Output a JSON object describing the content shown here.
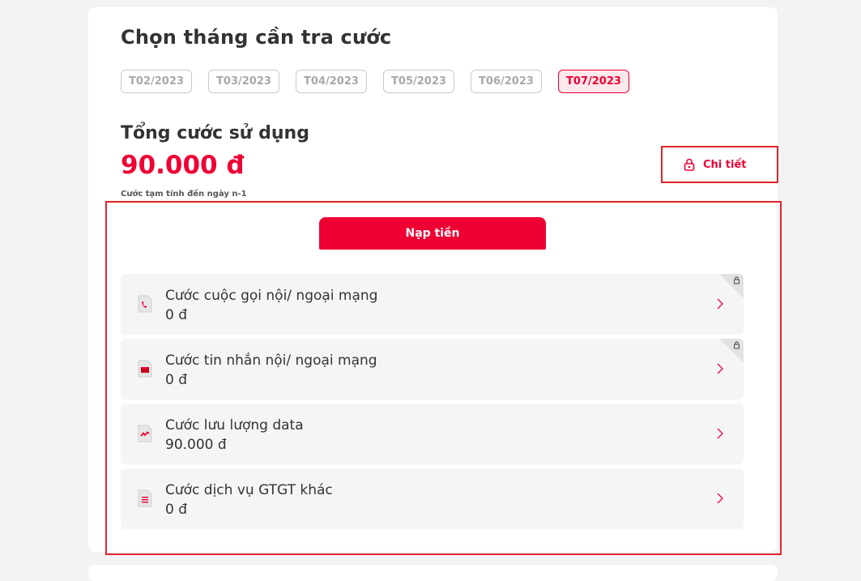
{
  "header": {
    "title": "Chọn tháng cần tra cước"
  },
  "months": [
    {
      "label": "T02/2023",
      "active": false
    },
    {
      "label": "T03/2023",
      "active": false
    },
    {
      "label": "T04/2023",
      "active": false
    },
    {
      "label": "T05/2023",
      "active": false
    },
    {
      "label": "T06/2023",
      "active": false
    },
    {
      "label": "T07/2023",
      "active": true
    }
  ],
  "summary": {
    "label": "Tổng cước sử dụng",
    "amount": "90.000 đ",
    "note": "Cước tạm tính đến ngày n-1",
    "detail_label": "Chi tiết"
  },
  "topup": {
    "label": "Nạp tiền"
  },
  "items": [
    {
      "label": "Cước cuộc gọi nội/ ngoại mạng",
      "value": "0 đ",
      "icon": "phone-icon",
      "locked": true
    },
    {
      "label": "Cước tin nhắn nội/ ngoại mạng",
      "value": "0 đ",
      "icon": "message-icon",
      "locked": true
    },
    {
      "label": "Cước lưu lượng data",
      "value": "90.000 đ",
      "icon": "data-icon",
      "locked": false
    },
    {
      "label": "Cước dịch vụ GTGT khác",
      "value": "0 đ",
      "icon": "service-icon",
      "locked": false
    }
  ],
  "colors": {
    "accent": "#ee0033",
    "highlight": "#e2232a",
    "text": "#333333"
  }
}
